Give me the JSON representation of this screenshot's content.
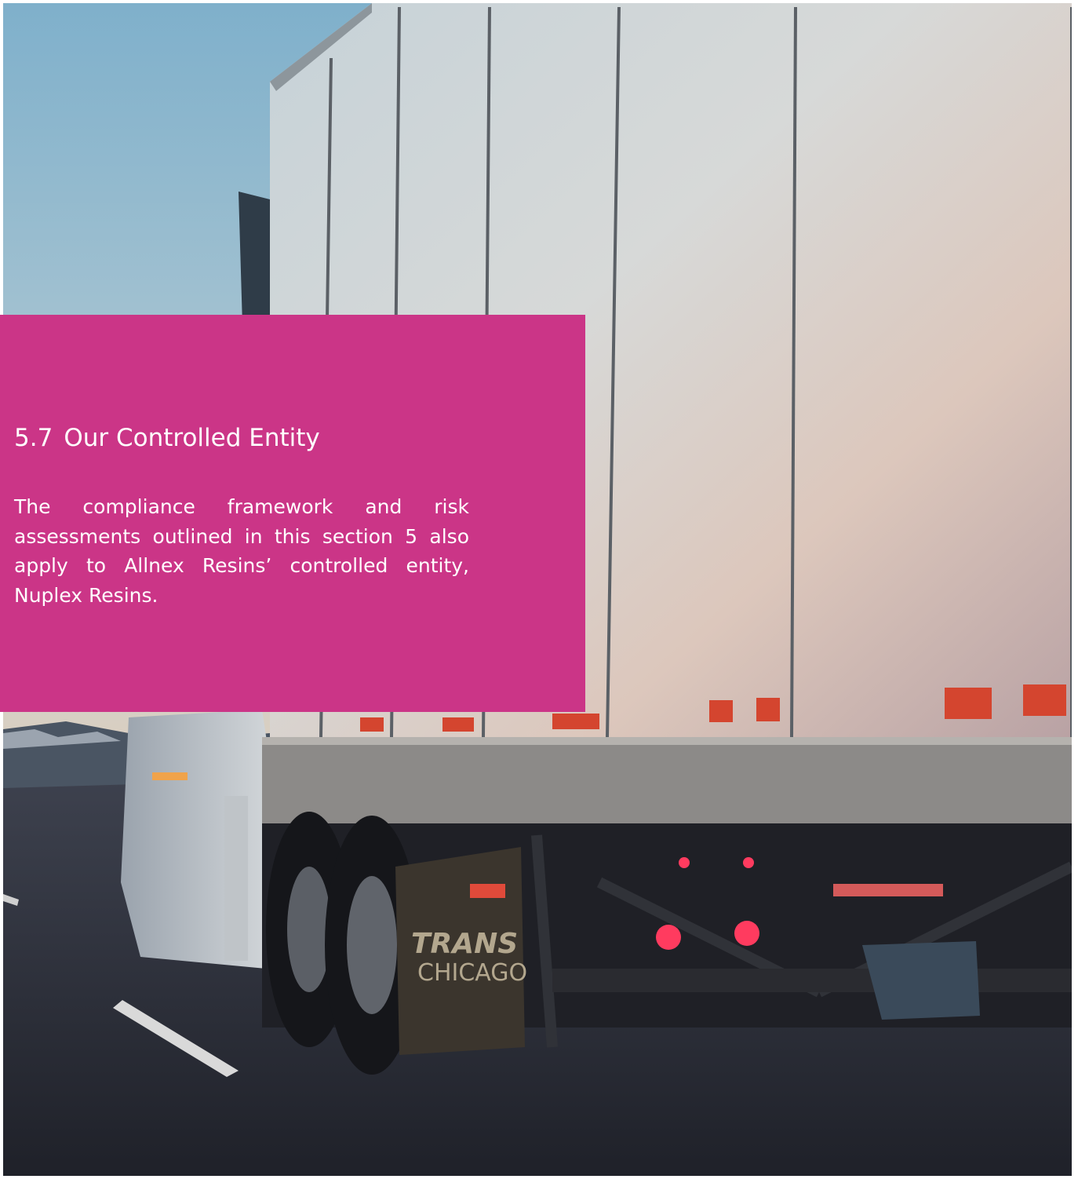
{
  "section": {
    "number": "5.7",
    "title": "Our Controlled Entity",
    "body": "The compliance framework and risk assessments outlined in this section 5 also apply to Allnex Resins’ controlled entity, Nuplex Resins."
  },
  "colors": {
    "panel": "#cb3587",
    "text": "#ffffff"
  },
  "photo": {
    "subject": "semi-truck-trailer-on-highway-at-dusk"
  }
}
